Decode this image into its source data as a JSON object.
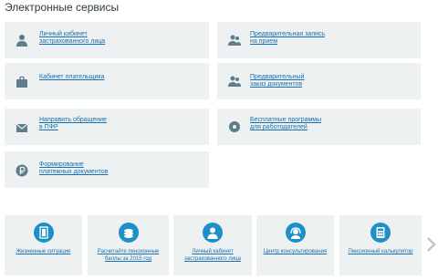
{
  "title": "Электронные сервисы",
  "services": [
    {
      "line1": "Личный кабинет",
      "line2": "застрахованного лица",
      "icon": "person-icon"
    },
    {
      "line1": "Предварительная запись",
      "line2": "на прием",
      "icon": "people-icon"
    },
    {
      "line1": "Кабинет плательщика",
      "line2": "",
      "icon": "briefcase-icon"
    },
    {
      "line1": "Предварительный",
      "line2": "заказ документов",
      "icon": "people-icon"
    },
    {
      "line1": "Направить обращение",
      "line2": "в ПФР",
      "icon": "envelope-icon"
    },
    {
      "line1": "Бесплатные программы",
      "line2": "для работодателей",
      "icon": "disc-icon"
    },
    {
      "line1": "Формирование",
      "line2": "платежных документов",
      "icon": "ruble-icon"
    }
  ],
  "bottom": [
    {
      "line1": "Жизненные ситуации",
      "line2": "",
      "icon": "door-icon"
    },
    {
      "line1": "Расчитайте пенсионные",
      "line2": "баллы за 2015 год",
      "icon": "coins-icon"
    },
    {
      "line1": "Личный кабинет",
      "line2": "застрахованного лица",
      "icon": "person-icon"
    },
    {
      "line1": "Центр консультирования",
      "line2": "",
      "icon": "headset-icon"
    },
    {
      "line1": "Пенсионный калькулятор",
      "line2": "",
      "icon": "calculator-icon"
    }
  ],
  "colors": {
    "tile_bg": "#eef1f2",
    "link": "#1a6fb0",
    "icon_dark": "#5f7d8c",
    "accent_circle": "#1f8fc7"
  }
}
